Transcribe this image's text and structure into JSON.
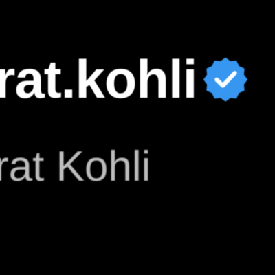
{
  "profile": {
    "username": "rat.kohli",
    "display_name": "rat Kohli",
    "verified_icon": "verified-badge-icon"
  },
  "colors": {
    "background": "#000000",
    "username": "#ffffff",
    "display_name": "#bdbdbd",
    "verified_badge": "#3797f0"
  }
}
